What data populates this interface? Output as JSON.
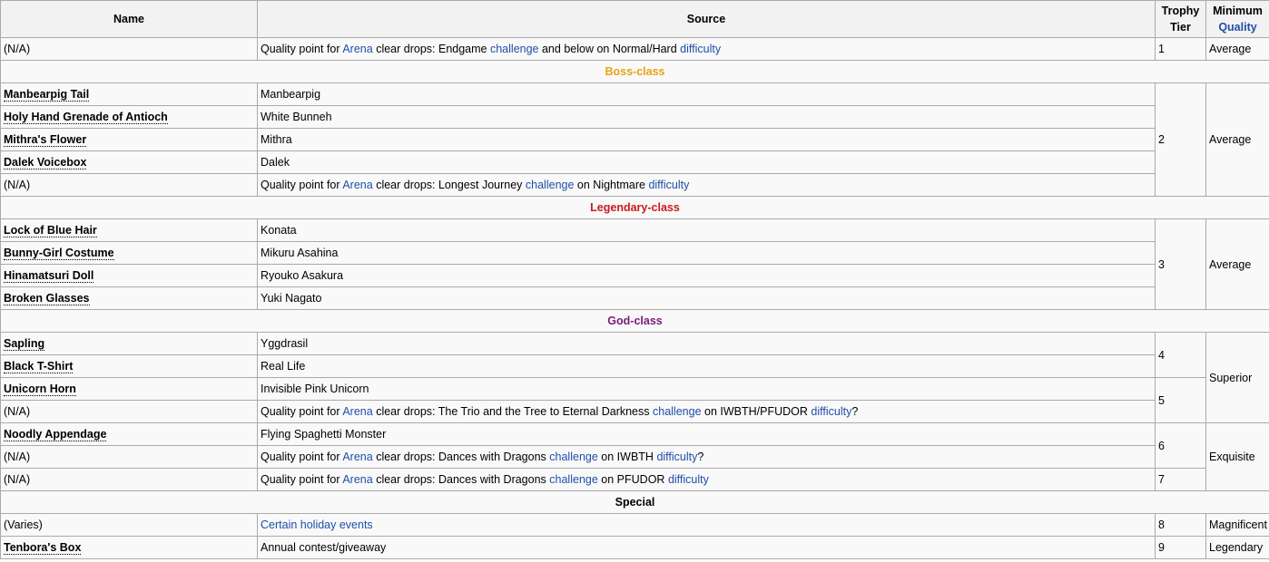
{
  "headers": {
    "name": "Name",
    "source": "Source",
    "tier_line1": "Trophy",
    "tier_line2": "Tier",
    "quality_line1": "Minimum",
    "quality_line2": "Quality"
  },
  "sections": {
    "boss": "Boss-class",
    "legendary": "Legendary-class",
    "god": "God-class",
    "special": "Special"
  },
  "words": {
    "qp_prefix": "Quality point for",
    "arena": "Arena",
    "clear_drops": "clear drops:",
    "challenge": "challenge",
    "on": "on",
    "difficulty": "difficulty",
    "and_below": "and below on Normal/Hard",
    "question": "?"
  },
  "rows": [
    {
      "name": "(N/A)",
      "challenge_name": "Endgame",
      "tier": "1",
      "quality": "Average"
    },
    {
      "name": "Manbearpig Tail",
      "source": "Manbearpig",
      "tier": "2",
      "quality": "Average"
    },
    {
      "name": "Holy Hand Grenade of Antioch",
      "source": "White Bunneh"
    },
    {
      "name": "Mithra's Flower",
      "source": "Mithra"
    },
    {
      "name": "Dalek Voicebox",
      "source": "Dalek"
    },
    {
      "name": "(N/A)",
      "challenge_name": "Longest Journey",
      "difficulty_name": "Nightmare"
    },
    {
      "name": "Lock of Blue Hair",
      "source": "Konata",
      "tier": "3",
      "quality": "Average"
    },
    {
      "name": "Bunny-Girl Costume",
      "source": "Mikuru Asahina"
    },
    {
      "name": "Hinamatsuri Doll",
      "source": "Ryouko Asakura"
    },
    {
      "name": "Broken Glasses",
      "source": "Yuki Nagato"
    },
    {
      "name": "Sapling",
      "source": "Yggdrasil",
      "tier": "4",
      "quality": "Superior"
    },
    {
      "name": "Black T-Shirt",
      "source": "Real Life"
    },
    {
      "name": "Unicorn Horn",
      "source": "Invisible Pink Unicorn",
      "tier": "5"
    },
    {
      "name": "(N/A)",
      "challenge_name": "The Trio and the Tree to Eternal Darkness",
      "difficulty_name": "IWBTH/PFUDOR"
    },
    {
      "name": "Noodly Appendage",
      "source": "Flying Spaghetti Monster",
      "tier": "6",
      "quality": "Exquisite"
    },
    {
      "name": "(N/A)",
      "challenge_name": "Dances with Dragons",
      "difficulty_name": "IWBTH"
    },
    {
      "name": "(N/A)",
      "challenge_name": "Dances with Dragons",
      "difficulty_name": "PFUDOR",
      "tier": "7"
    },
    {
      "name": "(Varies)",
      "source": "Certain holiday events",
      "tier": "8",
      "quality": "Magnificent"
    },
    {
      "name": "Tenbora's Box",
      "source": "Annual contest/giveaway",
      "tier": "9",
      "quality": "Legendary"
    }
  ]
}
